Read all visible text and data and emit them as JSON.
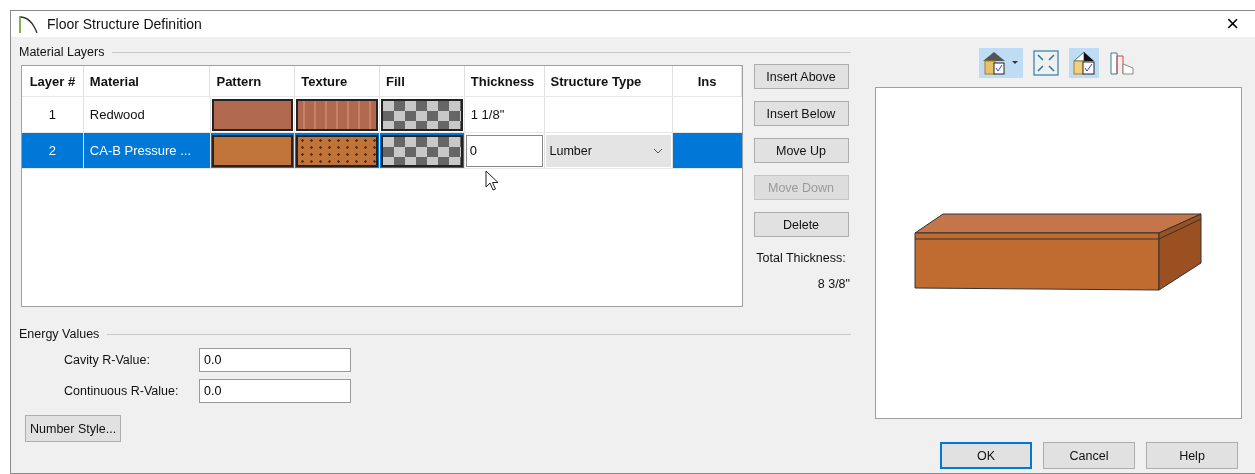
{
  "window": {
    "title": "Floor Structure Definition",
    "close": "×"
  },
  "material_layers": {
    "label": "Material Layers",
    "columns": [
      "Layer #",
      "Material",
      "Pattern",
      "Texture",
      "Fill",
      "Thickness",
      "Structure Type",
      "Ins"
    ],
    "rows": [
      {
        "layer": "1",
        "material": "Redwood",
        "color": "#b0684f",
        "kind": "grain",
        "thickness": "1 1/8\"",
        "editing": false,
        "selected": false
      },
      {
        "layer": "2",
        "material": "CA-B Pressure ...",
        "color": "#c0743a",
        "kind": "speckled",
        "thickness": "0",
        "structure_type": "Lumber",
        "editing": true,
        "selected": true
      }
    ]
  },
  "side_buttons": [
    {
      "label": "Insert Above",
      "disabled": false
    },
    {
      "label": "Insert Below",
      "disabled": false
    },
    {
      "label": "Move Up",
      "disabled": false
    },
    {
      "label": "Move Down",
      "disabled": true
    },
    {
      "label": "Delete",
      "disabled": false
    }
  ],
  "total_thickness": {
    "label": "Total Thickness:",
    "value": "8 3/8\""
  },
  "energy_values": {
    "label": "Energy Values",
    "fields": [
      {
        "label": "Cavity R-Value:",
        "value": "0.0"
      },
      {
        "label": "Continuous R-Value:",
        "value": "0.0"
      }
    ]
  },
  "number_style_button": "Number Style...",
  "preview_toolbar": [
    {
      "kind": "house",
      "selected": true
    },
    {
      "kind": "fit",
      "selected": false
    },
    {
      "kind": "split",
      "selected": true
    },
    {
      "kind": "layers",
      "selected": false
    }
  ],
  "buttons": [
    {
      "label": "OK",
      "focused": true
    },
    {
      "label": "Cancel",
      "focused": false
    },
    {
      "label": "Help",
      "focused": false
    }
  ]
}
